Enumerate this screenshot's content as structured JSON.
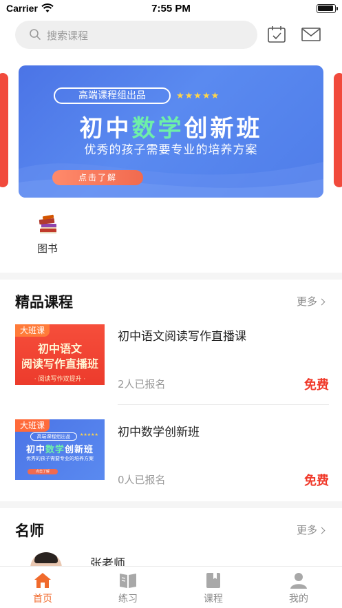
{
  "status_bar": {
    "carrier": "Carrier",
    "time": "7:55 PM"
  },
  "search": {
    "placeholder": "搜索课程"
  },
  "header_icons": [
    "calendar-check-icon",
    "mail-icon"
  ],
  "banner": {
    "tag": "高端课程组出品",
    "stars": "★★★★★",
    "title_prefix": "初中",
    "title_highlight": "数学",
    "title_suffix": "创新班",
    "subtitle": "优秀的孩子需要专业的培养方案",
    "cta": "点击了解"
  },
  "categories": [
    {
      "label": "图书",
      "icon": "books-icon"
    }
  ],
  "premium": {
    "title": "精品课程",
    "more": "更多",
    "courses": [
      {
        "name": "初中语文阅读写作直播课",
        "enrolled": "2人已报名",
        "price": "免费",
        "thumb": {
          "badge": "大班课",
          "line1": "初中语文",
          "line2": "阅读写作直播班",
          "line3": "· 阅读写作双提升 ·"
        }
      },
      {
        "name": "初中数学创新班",
        "enrolled": "0人已报名",
        "price": "免费",
        "thumb": {
          "badge": "大班课",
          "tag": "高端课程组出品",
          "stars": "★★★★★",
          "title_prefix": "初中",
          "title_highlight": "数学",
          "title_suffix": "创新班",
          "sub": "优秀的孩子需要专业的培养方案",
          "cta": "点击了解"
        }
      }
    ]
  },
  "teachers": {
    "title": "名师",
    "more": "更多",
    "items": [
      {
        "name": "张老师"
      }
    ]
  },
  "tabbar": {
    "active": "首页",
    "tabs": [
      {
        "label": "首页",
        "icon": "home-icon"
      },
      {
        "label": "练习",
        "icon": "book-open-icon"
      },
      {
        "label": "课程",
        "icon": "course-book-icon"
      },
      {
        "label": "我的",
        "icon": "person-icon"
      }
    ]
  },
  "colors": {
    "accent": "#f06a2c",
    "price": "#f03a2b",
    "banner_blue": "#4f7de9"
  }
}
